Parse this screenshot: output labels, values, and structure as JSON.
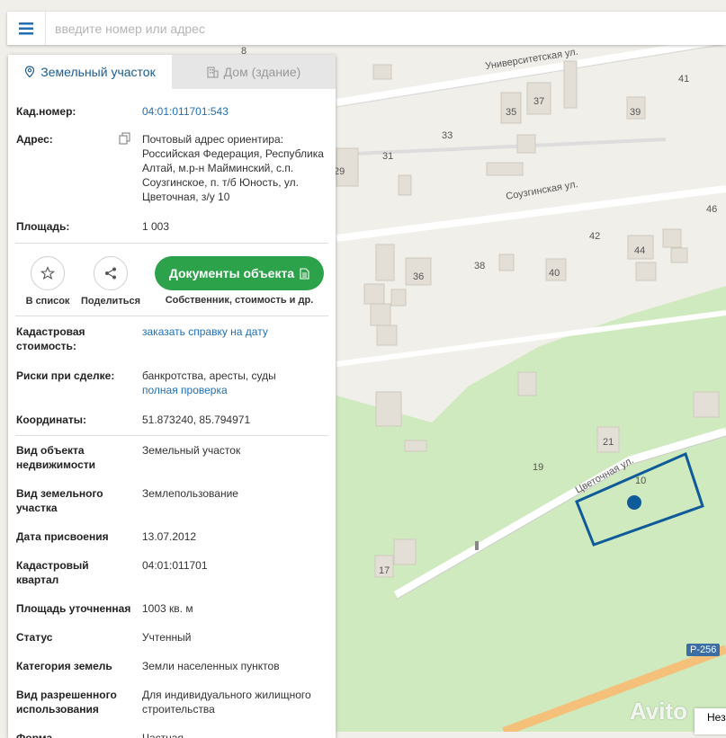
{
  "search": {
    "placeholder": "введите номер или адрес"
  },
  "tabs": [
    {
      "label": "Земельный участок"
    },
    {
      "label": "Дом (здание)"
    }
  ],
  "fields_top": {
    "cad_label": "Кад.номер:",
    "cad_value": "04:01:011701:543",
    "addr_label": "Адрес:",
    "addr_value": "Почтовый адрес ориентира: Российская Федерация, Республика Алтай, м.р-н Майминский, с.п. Соузгинское, п. т/б Юность, ул. Цветочная, з/у 10",
    "area_label": "Площадь:",
    "area_value": "1 003"
  },
  "actions": {
    "favorite": "В список",
    "share": "Поделиться",
    "documents": "Документы объекта",
    "documents_sub": "Собственник, стоимость и др."
  },
  "fields_mid": {
    "cost_label": "Кадастровая стоимость:",
    "cost_link": "заказать справку на дату",
    "risk_label": "Риски при сделке:",
    "risk_value": "банкротства, аресты, суды",
    "risk_link": "полная проверка",
    "coord_label": "Координаты:",
    "coord_value": "51.873240, 85.794971"
  },
  "details": [
    {
      "label": "Вид объекта недвижимости",
      "value": "Земельный участок"
    },
    {
      "label": "Вид земельного участка",
      "value": "Землепользование"
    },
    {
      "label": "Дата присвоения",
      "value": "13.07.2012"
    },
    {
      "label": "Кадастровый квартал",
      "value": "04:01:011701"
    },
    {
      "label": "Площадь уточненная",
      "value": "1003 кв. м"
    },
    {
      "label": "Статус",
      "value": "Учтенный"
    },
    {
      "label": "Категория земель",
      "value": "Земли населенных пунктов"
    },
    {
      "label": "Вид разрешенного использования",
      "value": "Для индивидуального жилищного строительства"
    },
    {
      "label": "Форма",
      "value": "Частная"
    }
  ],
  "map": {
    "streets": [
      "Университетская ул.",
      "Соузгинская ул.",
      "Цветочная ул."
    ],
    "numbers": [
      "8",
      "41",
      "35",
      "37",
      "39",
      "33",
      "31",
      "29",
      "46",
      "42",
      "44",
      "36",
      "38",
      "40",
      "21",
      "19",
      "10",
      "17"
    ],
    "road_badge": "Р-256",
    "watermark": "Avito",
    "corner_text": "Нез"
  },
  "colors": {
    "accent": "#1f6fb2",
    "button_green": "#2ca34a",
    "parcel": "#0f5a99",
    "grass": "#cfeabf"
  }
}
